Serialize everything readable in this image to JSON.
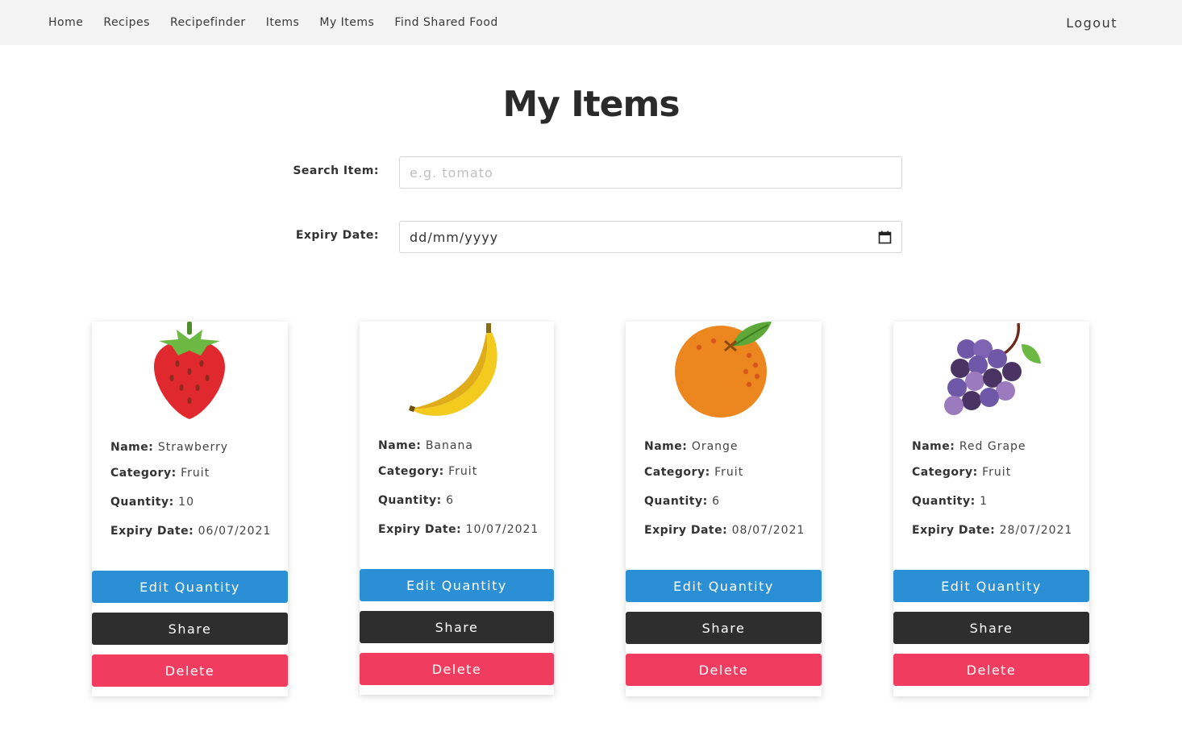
{
  "nav": {
    "links": [
      "Home",
      "Recipes",
      "Recipefinder",
      "Items",
      "My Items",
      "Find Shared Food"
    ],
    "logout": "Logout"
  },
  "page": {
    "title": "My Items"
  },
  "search": {
    "label": "Search Item:",
    "placeholder": "e.g. tomato",
    "value": ""
  },
  "expiry_filter": {
    "label": "Expiry Date:",
    "value": "dd/mm/yyyy",
    "icon": "calendar-icon"
  },
  "labels": {
    "name": "Name:",
    "category": "Category:",
    "quantity": "Quantity:",
    "expiry": "Expiry Date:"
  },
  "buttons": {
    "edit": "Edit Quantity",
    "share": "Share",
    "delete": "Delete"
  },
  "colors": {
    "edit": "#2b8fd6",
    "share": "#2e2e2e",
    "delete": "#f03c5e",
    "navbar": "#f3f3f3"
  },
  "items": [
    {
      "name": "Strawberry",
      "category": "Fruit",
      "quantity": "10",
      "expiry": "06/07/2021",
      "icon": "strawberry-icon"
    },
    {
      "name": "Banana",
      "category": "Fruit",
      "quantity": "6",
      "expiry": "10/07/2021",
      "icon": "banana-icon"
    },
    {
      "name": "Orange",
      "category": "Fruit",
      "quantity": "6",
      "expiry": "08/07/2021",
      "icon": "orange-icon"
    },
    {
      "name": "Red Grape",
      "category": "Fruit",
      "quantity": "1",
      "expiry": "28/07/2021",
      "icon": "grape-icon"
    }
  ]
}
